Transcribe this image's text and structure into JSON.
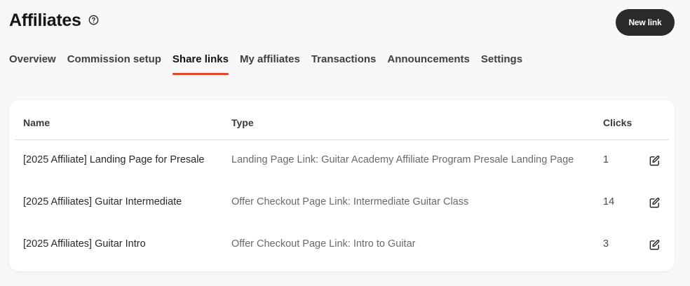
{
  "header": {
    "title": "Affiliates",
    "help_icon": "question-circle-icon",
    "new_link_label": "New link"
  },
  "tabs": [
    {
      "label": "Overview",
      "active": false
    },
    {
      "label": "Commission setup",
      "active": false
    },
    {
      "label": "Share links",
      "active": true
    },
    {
      "label": "My affiliates",
      "active": false
    },
    {
      "label": "Transactions",
      "active": false
    },
    {
      "label": "Announcements",
      "active": false
    },
    {
      "label": "Settings",
      "active": false
    }
  ],
  "table": {
    "columns": {
      "name": "Name",
      "type": "Type",
      "clicks": "Clicks"
    },
    "rows": [
      {
        "name": "[2025 Affiliate] Landing Page for Presale",
        "type": "Landing Page Link: Guitar Academy Affiliate Program Presale Landing Page",
        "clicks": "1"
      },
      {
        "name": "[2025 Affiliates] Guitar Intermediate",
        "type": "Offer Checkout Page Link: Intermediate Guitar Class",
        "clicks": "14"
      },
      {
        "name": "[2025 Affiliates] Guitar Intro",
        "type": "Offer Checkout Page Link: Intro to Guitar",
        "clicks": "3"
      }
    ],
    "edit_icon": "edit-pencil-icon"
  },
  "colors": {
    "accent": "#e2492f",
    "button_bg": "#2b2a28",
    "page_bg": "#f7f7f7"
  }
}
